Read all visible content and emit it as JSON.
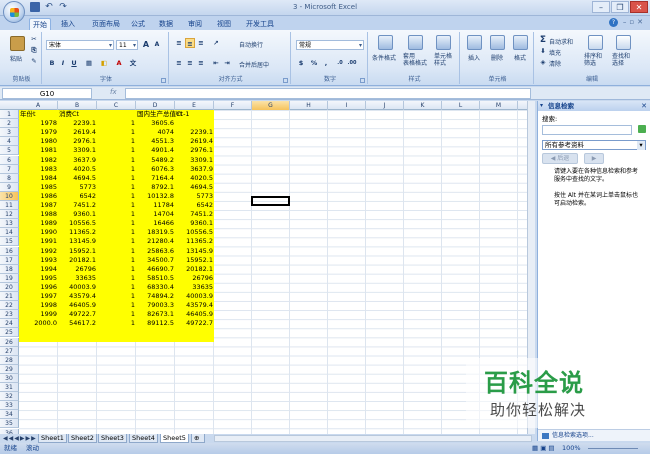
{
  "window": {
    "title": "3 - Microsoft Excel"
  },
  "tabs": [
    "开始",
    "插入",
    "页面布局",
    "公式",
    "数据",
    "审阅",
    "视图",
    "开发工具"
  ],
  "ribbon": {
    "clipboard": {
      "label": "剪贴板",
      "paste": "粘贴"
    },
    "font": {
      "label": "字体",
      "name": "宋体",
      "size": "11",
      "bold": "B",
      "italic": "I",
      "underline": "U",
      "grow": "A",
      "shrink": "A"
    },
    "alignment": {
      "label": "对齐方式",
      "wrap": "自动换行",
      "merge": "合并后居中"
    },
    "number": {
      "label": "数字",
      "format": "常规",
      "percent": "%",
      "comma": ","
    },
    "styles": {
      "label": "样式",
      "cond": "条件格式",
      "table": "套用\n表格格式",
      "cell": "单元格\n样式"
    },
    "cells": {
      "label": "单元格",
      "insert": "插入",
      "delete": "删除",
      "format": "格式"
    },
    "editing": {
      "label": "编辑",
      "autosum": "自动求和",
      "fill": "填充",
      "clear": "清除",
      "sort": "排序和\n筛选",
      "find": "查找和\n选择"
    }
  },
  "formula_bar": {
    "name_box": "G10",
    "fx": "fx",
    "value": ""
  },
  "columns": [
    "A",
    "B",
    "C",
    "D",
    "E",
    "F",
    "G",
    "H",
    "I",
    "J",
    "K",
    "L",
    "M"
  ],
  "rows": [
    [
      "年份t",
      "消费Ct",
      "",
      "国内生产总值Yt",
      "Ct-1"
    ],
    [
      "1978",
      "2239.1",
      "1",
      "3605.6",
      ""
    ],
    [
      "1979",
      "2619.4",
      "1",
      "4074",
      "2239.1"
    ],
    [
      "1980",
      "2976.1",
      "1",
      "4551.3",
      "2619.4"
    ],
    [
      "1981",
      "3309.1",
      "1",
      "4901.4",
      "2976.1"
    ],
    [
      "1982",
      "3637.9",
      "1",
      "5489.2",
      "3309.1"
    ],
    [
      "1983",
      "4020.5",
      "1",
      "6076.3",
      "3637.9"
    ],
    [
      "1984",
      "4694.5",
      "1",
      "7164.4",
      "4020.5"
    ],
    [
      "1985",
      "5773",
      "1",
      "8792.1",
      "4694.5"
    ],
    [
      "1986",
      "6542",
      "1",
      "10132.8",
      "5773"
    ],
    [
      "1987",
      "7451.2",
      "1",
      "11784",
      "6542"
    ],
    [
      "1988",
      "9360.1",
      "1",
      "14704",
      "7451.2"
    ],
    [
      "1989",
      "10556.5",
      "1",
      "16466",
      "9360.1"
    ],
    [
      "1990",
      "11365.2",
      "1",
      "18319.5",
      "10556.5"
    ],
    [
      "1991",
      "13145.9",
      "1",
      "21280.4",
      "11365.2"
    ],
    [
      "1992",
      "15952.1",
      "1",
      "25863.6",
      "13145.9"
    ],
    [
      "1993",
      "20182.1",
      "1",
      "34500.7",
      "15952.1"
    ],
    [
      "1994",
      "26796",
      "1",
      "46690.7",
      "20182.1"
    ],
    [
      "1995",
      "33635",
      "1",
      "58510.5",
      "26796"
    ],
    [
      "1996",
      "40003.9",
      "1",
      "68330.4",
      "33635"
    ],
    [
      "1997",
      "43579.4",
      "1",
      "74894.2",
      "40003.9"
    ],
    [
      "1998",
      "46405.9",
      "1",
      "79003.3",
      "43579.4"
    ],
    [
      "1999",
      "49722.7",
      "1",
      "82673.1",
      "46405.9"
    ],
    [
      "2000.0",
      "54617.2",
      "1",
      "89112.5",
      "49722.7"
    ]
  ],
  "row_numbers": [
    "1",
    "2",
    "3",
    "4",
    "5",
    "6",
    "7",
    "8",
    "9",
    "10",
    "11",
    "12",
    "13",
    "14",
    "15",
    "16",
    "17",
    "18",
    "19",
    "20",
    "21",
    "22",
    "23",
    "24",
    "25",
    "26",
    "27",
    "28",
    "29",
    "30",
    "31",
    "32",
    "33",
    "34",
    "35",
    "36"
  ],
  "selected_row": "10",
  "selected_col": "G",
  "research_pane": {
    "title": "信息检索",
    "search_label": "搜索:",
    "scope": "所有参考资料",
    "back": "◀ 后退",
    "forward": "▶",
    "message": "请键入要在各种信息检索和参考服务中查找的文字。\n\n按住 Alt 并在某词上单击鼠标也可启动检索。",
    "footer": "信息检索选项..."
  },
  "sheets": [
    "Sheet1",
    "Sheet2",
    "Sheet3",
    "Sheet4",
    "Sheet5"
  ],
  "active_sheet": "Sheet5",
  "status": {
    "ready": "就绪",
    "mode": "滚动",
    "zoom": "100%"
  },
  "watermark": {
    "title": "百科全说",
    "subtitle": "助你轻松解决"
  }
}
